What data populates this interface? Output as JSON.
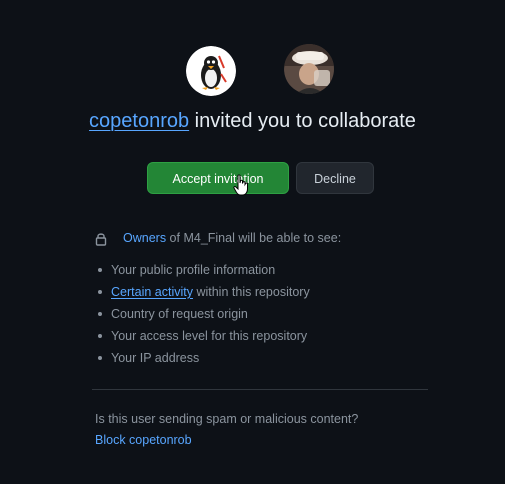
{
  "avatars": {
    "inviter_icon": "penguin-avatar-icon",
    "invitee_icon": "user-photo-avatar-icon"
  },
  "headline": {
    "username": "copetonrob",
    "text": " invited you to collaborate"
  },
  "buttons": {
    "accept_label": "Accept invitation",
    "decline_label": "Decline"
  },
  "info": {
    "owners_link": "Owners",
    "rest": " of M4_Final will be able to see:"
  },
  "permissions": [
    {
      "text": "Your public profile information"
    },
    {
      "link": "Certain activity",
      "text": " within this repository"
    },
    {
      "text": "Country of request origin"
    },
    {
      "text": "Your access level for this repository"
    },
    {
      "text": "Your IP address"
    }
  ],
  "spam": {
    "question": "Is this user sending spam or malicious content?",
    "block_link": "Block copetonrob"
  },
  "colors": {
    "background": "#0d1117",
    "accept": "#238636",
    "link": "#58a6ff",
    "muted": "#8b949e"
  }
}
